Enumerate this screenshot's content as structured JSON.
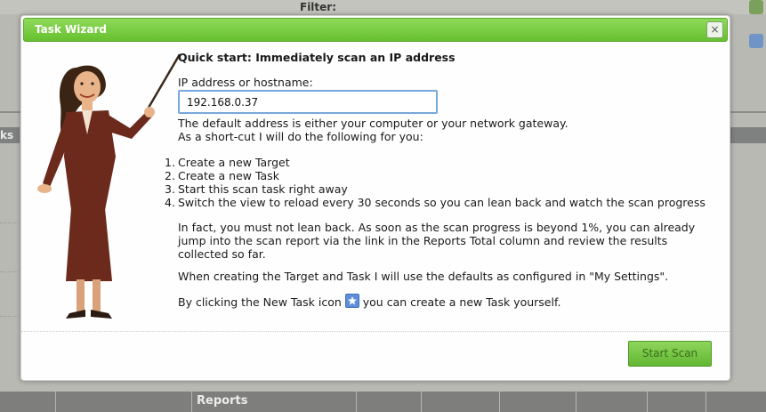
{
  "background": {
    "filter_label": "Filter:",
    "left_tab_label": "ks",
    "bottom_reports_label": "Reports"
  },
  "dialog": {
    "title": "Task Wizard",
    "close_glyph": "×",
    "heading": "Quick start: Immediately scan an IP address",
    "ip_label": "IP address or hostname:",
    "ip_value": "192.168.0.37",
    "intro_line1": "The default address is either your computer or your network gateway.",
    "intro_line2": "As a short-cut I will do the following for you:",
    "steps": [
      {
        "num": "1.",
        "text": "Create a new Target"
      },
      {
        "num": "2.",
        "text": "Create a new Task"
      },
      {
        "num": "3.",
        "text": "Start this scan task right away"
      },
      {
        "num": "4.",
        "text": "Switch the view to reload every 30 seconds so you can lean back and watch the scan progress"
      }
    ],
    "lean_back_text": "In fact, you must not lean back. As soon as the scan progress is beyond 1%, you can already jump into the scan report via the link in the Reports Total column and review the results collected so far.",
    "defaults_text": "When creating the Target and Task I will use the defaults as configured in \"My Settings\".",
    "new_task_before": "By clicking the New Task icon",
    "new_task_after": "you can create a new Task yourself.",
    "start_button": "Start Scan"
  },
  "colors": {
    "title_bar": "#66c02f",
    "input_border": "#78a8dc",
    "start_button": "#62b732"
  }
}
